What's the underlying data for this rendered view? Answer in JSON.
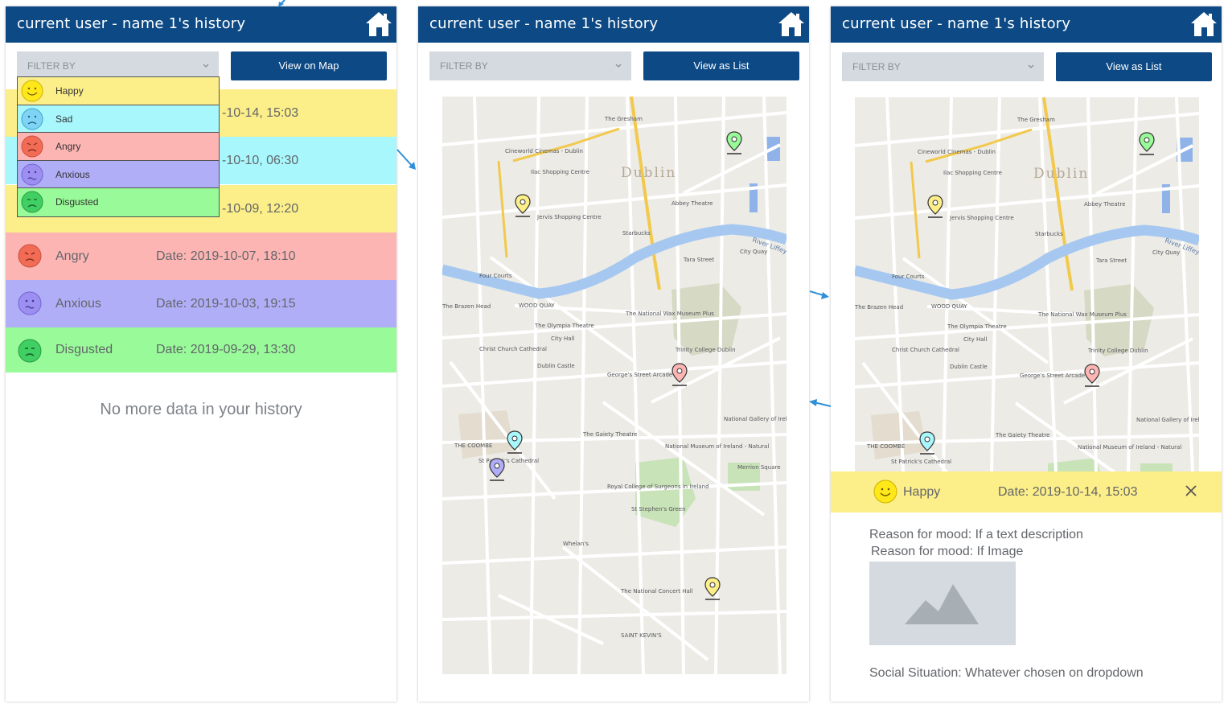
{
  "app_title": "current user - name 1's history",
  "colors": {
    "header": "#0d4a85",
    "happy": "#fcee88",
    "sad": "#a7f7fc",
    "angry": "#fdb5b3",
    "anxious": "#b1aef8",
    "disgusted": "#98fa98"
  },
  "screen1": {
    "filter_label": "FILTER BY",
    "view_button": "View on Map",
    "dropdown": [
      {
        "label": "Happy",
        "mood": "happy"
      },
      {
        "label": "Sad",
        "mood": "sad"
      },
      {
        "label": "Angry",
        "mood": "angry"
      },
      {
        "label": "Anxious",
        "mood": "anxious"
      },
      {
        "label": "Disgusted",
        "mood": "disgusted"
      }
    ],
    "partial_dates": [
      "-10-14, 15:03",
      "-10-10, 06:30",
      "-10-09, 12:20"
    ],
    "rows": [
      {
        "mood": "Angry",
        "date": "Date: 2019-10-07, 18:10"
      },
      {
        "mood": "Anxious",
        "date": "Date: 2019-10-03, 19:15"
      },
      {
        "mood": "Disgusted",
        "date": "Date: 2019-09-29, 13:30"
      }
    ],
    "no_more": "No more data in your history"
  },
  "screen2": {
    "filter_label": "FILTER BY",
    "view_button": "View as List"
  },
  "screen3": {
    "filter_label": "FILTER BY",
    "view_button": "View as List",
    "detail": {
      "mood": "Happy",
      "date": "Date: 2019-10-14, 15:03",
      "reason_text": "Reason for mood: If a text description",
      "reason_image": "Reason for mood: If Image",
      "social": "Social Situation: Whatever chosen on dropdown"
    }
  },
  "map_labels": {
    "city": "Dublin",
    "river": "River Liffey",
    "places": [
      "The Gresham",
      "Cineworld Cinemas - Dublin",
      "Ilac Shopping Centre",
      "Jervis Shopping Centre",
      "Abbey Theatre",
      "Starbucks",
      "Tara Street",
      "Four Courts",
      "The Brazen Head",
      "The Olympia Theatre",
      "City Hall",
      "Christ Church Cathedral",
      "Dublin Castle",
      "George's Street Arcade",
      "Trinity College Dublin",
      "The National Wax Museum Plus",
      "The Gaiety Theatre",
      "National Museum of Ireland - Natural",
      "National Gallery of Ireland",
      "Merrion Square",
      "Royal College of Surgeons in Ireland",
      "St Stephen's Green",
      "The National Concert Hall",
      "St Patrick's Cathedral",
      "THE COOMBE",
      "SAINT KEVIN'S",
      "WOOD QUAY",
      "City Quay",
      "Whelan's"
    ]
  }
}
